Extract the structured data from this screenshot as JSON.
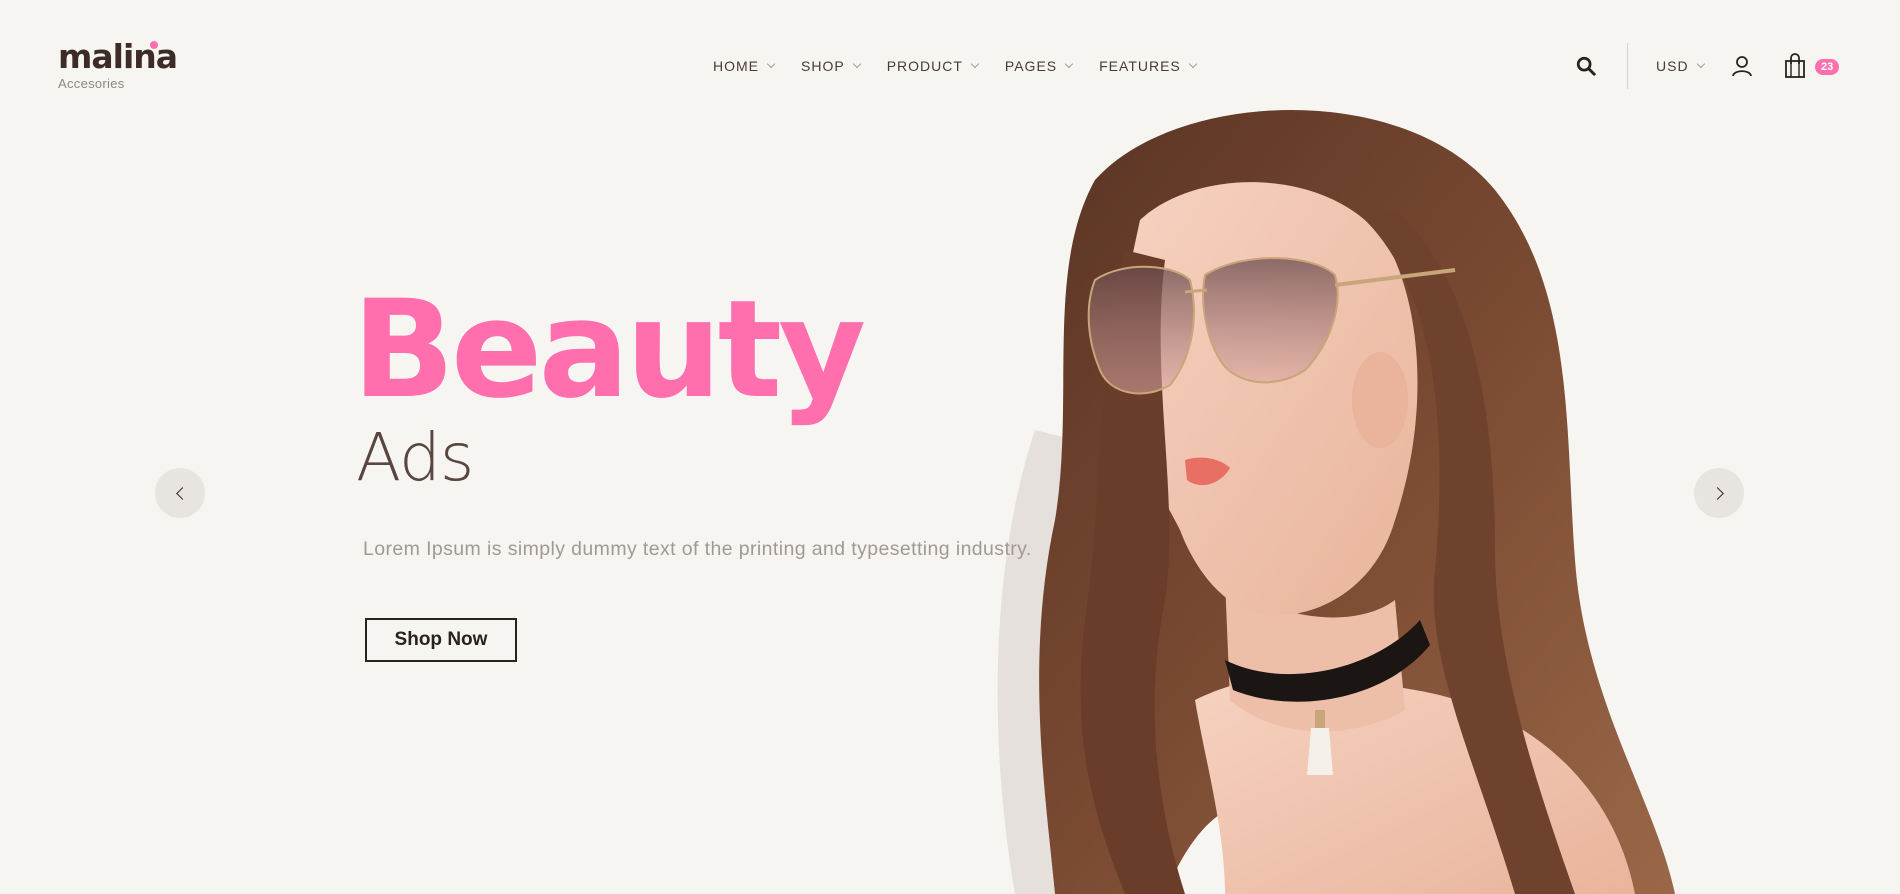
{
  "brand": {
    "name": "malina",
    "tagline": "Accesories",
    "accent_color": "#ff6fae"
  },
  "nav": {
    "items": [
      {
        "label": "HOME"
      },
      {
        "label": "SHOP"
      },
      {
        "label": "PRODUCT"
      },
      {
        "label": "PAGES"
      },
      {
        "label": "FEATURES"
      }
    ]
  },
  "header": {
    "search_icon": "search-icon",
    "currency": "USD",
    "account_icon": "user-icon",
    "cart_icon": "shopping-bag-icon",
    "cart_count": "23"
  },
  "hero": {
    "title": "Beauty",
    "subtitle": "Ads",
    "description": "Lorem Ipsum is simply dummy text of the printing and typesetting industry.",
    "cta_label": "Shop Now",
    "prev_icon": "chevron-left-icon",
    "next_icon": "chevron-right-icon"
  },
  "colors": {
    "background": "#f7f5f1",
    "text_dark": "#3d2b27",
    "muted": "#a09996",
    "accent": "#ff6fae"
  }
}
